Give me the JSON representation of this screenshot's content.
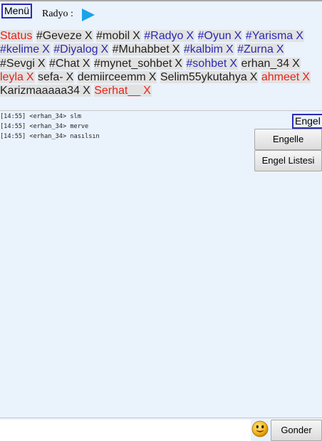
{
  "header": {
    "menu_label": "Menü",
    "radio_label": "Radyo :",
    "play_icon": "play-icon"
  },
  "colors": {
    "red": "#e5231c",
    "blue": "#2a2ab8",
    "play": "#1aa3e8"
  },
  "tabs": [
    {
      "label": "Status",
      "close": "",
      "color": "red"
    },
    {
      "label": "#Geveze",
      "close": "X",
      "color": "black"
    },
    {
      "label": "#mobil",
      "close": "X",
      "color": "black"
    },
    {
      "label": "#Radyo",
      "close": "X",
      "color": "blue"
    },
    {
      "label": "#Oyun",
      "close": "X",
      "color": "blue"
    },
    {
      "label": "#Yarisma",
      "close": "X",
      "color": "blue"
    },
    {
      "label": "#kelime",
      "close": "X",
      "color": "blue"
    },
    {
      "label": "#Diyalog",
      "close": "X",
      "color": "blue"
    },
    {
      "label": "#Muhabbet",
      "close": "X",
      "color": "black"
    },
    {
      "label": "#kalbim",
      "close": "X",
      "color": "blue"
    },
    {
      "label": "#Zurna",
      "close": "X",
      "color": "blue"
    },
    {
      "label": "#Sevgi",
      "close": "X",
      "color": "black"
    },
    {
      "label": "#Chat",
      "close": "X",
      "color": "black"
    },
    {
      "label": "#mynet_sohbet",
      "close": "X",
      "color": "black"
    },
    {
      "label": "#sohbet",
      "close": "X",
      "color": "blue"
    },
    {
      "label": "erhan_34",
      "close": "X",
      "color": "black"
    },
    {
      "label": "leyla",
      "close": "X",
      "color": "red"
    },
    {
      "label": "sefa-",
      "close": "X",
      "color": "black"
    },
    {
      "label": "demiirceemm",
      "close": "X",
      "color": "black"
    },
    {
      "label": "Selim55ykutahya",
      "close": "X",
      "color": "black"
    },
    {
      "label": "ahmeet",
      "close": "X",
      "color": "red"
    },
    {
      "label": "Karizmaaaaa34",
      "close": "X",
      "color": "black"
    },
    {
      "label": "Serhat__",
      "close": "X",
      "color": "red"
    }
  ],
  "messages": [
    {
      "time": "[14:55]",
      "user": "<erhan_34>",
      "text": "slm"
    },
    {
      "time": "[14:55]",
      "user": "<erhan_34>",
      "text": "merve"
    },
    {
      "time": "[14:55]",
      "user": "<erhan_34>",
      "text": "nasılsın"
    }
  ],
  "sidebar": {
    "engel_label": "Engel",
    "block_label": "Engelle",
    "block_list_label": "Engel Listesi"
  },
  "footer": {
    "input_value": "",
    "input_placeholder": "",
    "emoji_icon": "smiley-icon",
    "send_label": "Gonder"
  }
}
